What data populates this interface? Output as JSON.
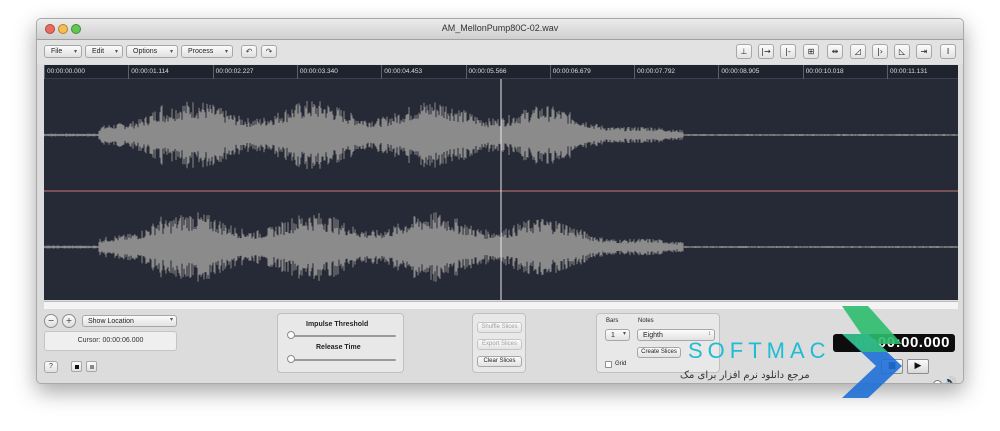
{
  "window": {
    "title": "AM_MellonPump80C-02.wav"
  },
  "toolbar": {
    "menus": [
      "File",
      "Edit",
      "Options",
      "Process"
    ],
    "undo_icon": "undo-icon",
    "redo_icon": "redo-icon",
    "tool_icons": [
      "lock-icon",
      "trim-start-icon",
      "trim-end-icon",
      "crop-icon",
      "normalize-icon",
      "fade-in-icon",
      "play-from-icon",
      "fade-out-icon",
      "split-icon",
      "cursor-icon"
    ]
  },
  "ruler": {
    "ticks": [
      "00:00:00.000",
      "00:00:01.114",
      "00:00:02.227",
      "00:00:03.340",
      "00:00:04.453",
      "00:00:05.566",
      "00:00:06.679",
      "00:00:07.792",
      "00:00:08.905",
      "00:00:10.018",
      "00:00:11.131"
    ]
  },
  "waveform": {
    "color": "#8b8b8b",
    "background": "#262a36",
    "cursor_position_fraction": 0.5
  },
  "bottom": {
    "location_select": "Show Location",
    "cursor_text": "Cursor: 00:00:06.000",
    "help_label": "?",
    "impulse_label": "Impulse Threshold",
    "release_label": "Release Time",
    "shuffle_label": "Shuffle Slices",
    "export_label": "Export Slices",
    "clear_label": "Clear Slices",
    "bars_label": "Bars",
    "bars_value": "1",
    "notes_label": "Notes",
    "notes_value": "Eighth",
    "create_label": "Create Slices",
    "grid_label": "Grid",
    "time_display": "00:00:00.000"
  },
  "watermark": {
    "brand": "SOFTMAC",
    "tagline": "مرجع دانلود نرم افزار برای مک"
  },
  "colors": {
    "accent": "#1fbcd4",
    "logo_green": "#2dbd6e",
    "logo_blue": "#1f6fd6"
  }
}
